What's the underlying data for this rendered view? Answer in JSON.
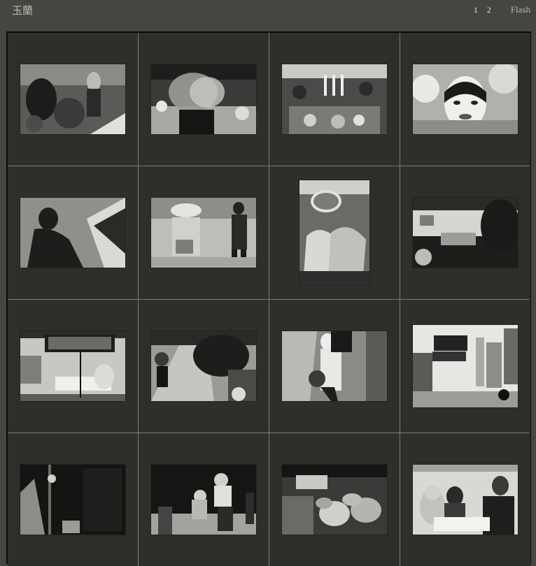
{
  "header": {
    "site_title": "玉蘭",
    "pages": [
      "1",
      "2"
    ],
    "flash_label": "Flash"
  },
  "gallery": {
    "photos": [
      {
        "name": "thumb-1",
        "shape": "landscape",
        "tone": "market-crowd"
      },
      {
        "name": "thumb-2",
        "shape": "landscape",
        "tone": "blurred-woman-market"
      },
      {
        "name": "thumb-3",
        "shape": "landscape",
        "tone": "stall-crowd"
      },
      {
        "name": "thumb-4",
        "shape": "landscape",
        "tone": "face-painting"
      },
      {
        "name": "thumb-5",
        "shape": "landscape",
        "tone": "shadow-basket"
      },
      {
        "name": "thumb-6",
        "shape": "landscape",
        "tone": "vendor-street"
      },
      {
        "name": "thumb-7",
        "shape": "portrait",
        "tone": "scooter-bags"
      },
      {
        "name": "thumb-8",
        "shape": "landscape",
        "tone": "dashboard"
      },
      {
        "name": "thumb-9",
        "shape": "landscape",
        "tone": "windshield"
      },
      {
        "name": "thumb-10",
        "shape": "landscape",
        "tone": "sidewalk"
      },
      {
        "name": "thumb-11",
        "shape": "landscape",
        "tone": "walking-bag"
      },
      {
        "name": "thumb-12",
        "shape": "tall",
        "tone": "city-street"
      },
      {
        "name": "thumb-13",
        "shape": "landscape",
        "tone": "dark-stairs"
      },
      {
        "name": "thumb-14",
        "shape": "landscape",
        "tone": "night-workers"
      },
      {
        "name": "thumb-15",
        "shape": "landscape",
        "tone": "baskets"
      },
      {
        "name": "thumb-16",
        "shape": "landscape",
        "tone": "office-cat"
      }
    ]
  }
}
